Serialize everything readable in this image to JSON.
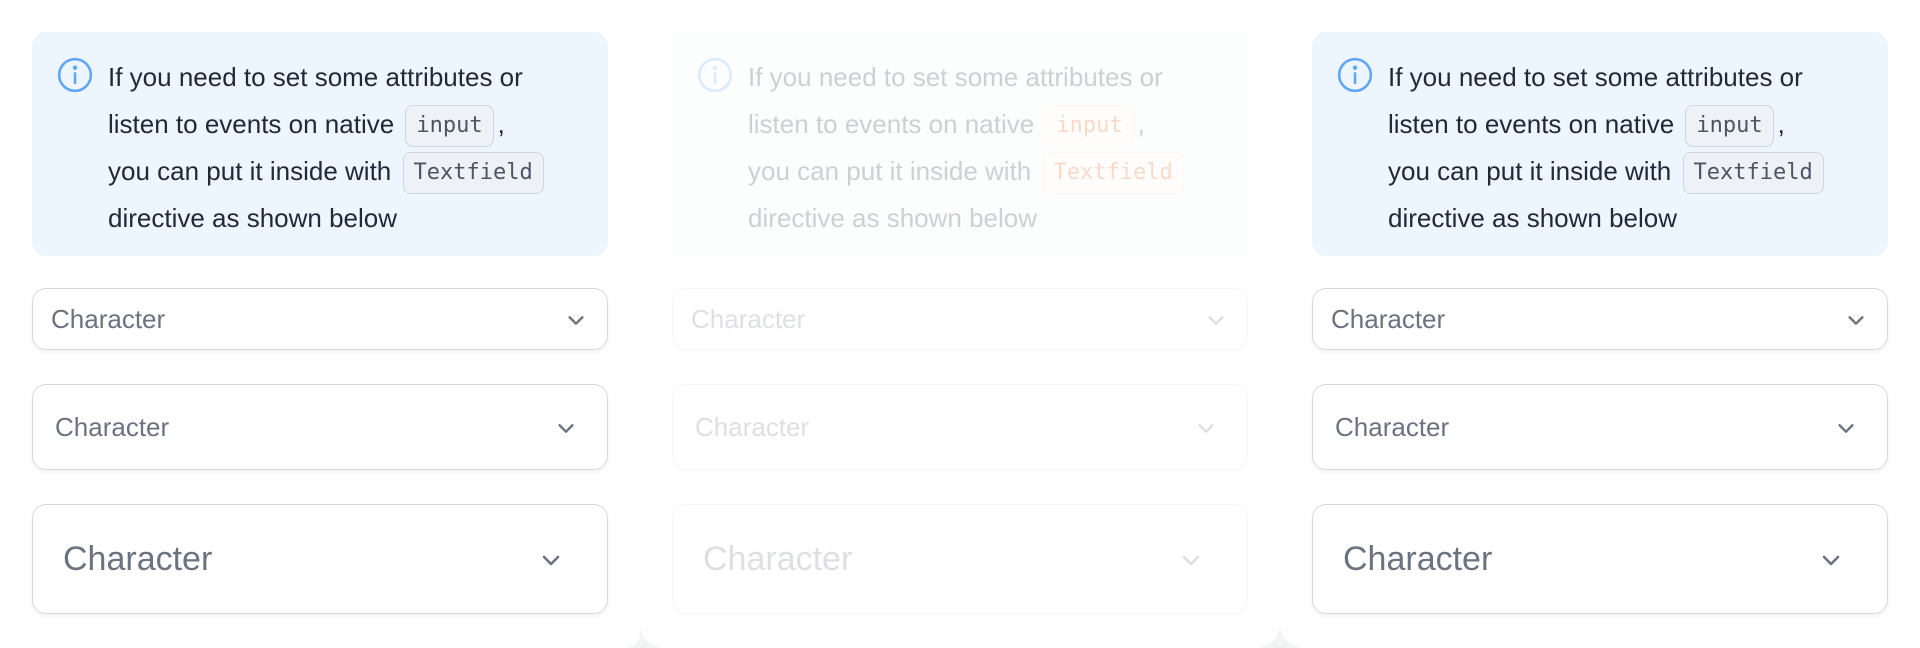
{
  "colors": {
    "info_accent": "#60a5fa",
    "alert_background": "#edf5fe",
    "code_text": "#4b5563",
    "code_text_highlight": "#ea580c",
    "select_text": "#6b7280"
  },
  "alert": {
    "icon": "info-circle-icon",
    "line1": "If you need to set some attributes or",
    "line2_prefix": "listen to events on native",
    "code_input": "input",
    "line2_suffix": ",",
    "line3_prefix": "you can put it inside with",
    "code_textfield": "Textfield",
    "line4": "directive as shown below"
  },
  "selects": {
    "small": {
      "value": "Character",
      "icon": "chevron-down-icon"
    },
    "medium": {
      "value": "Character",
      "icon": "chevron-down-icon"
    },
    "large": {
      "value": "Character",
      "icon": "chevron-down-icon"
    }
  }
}
